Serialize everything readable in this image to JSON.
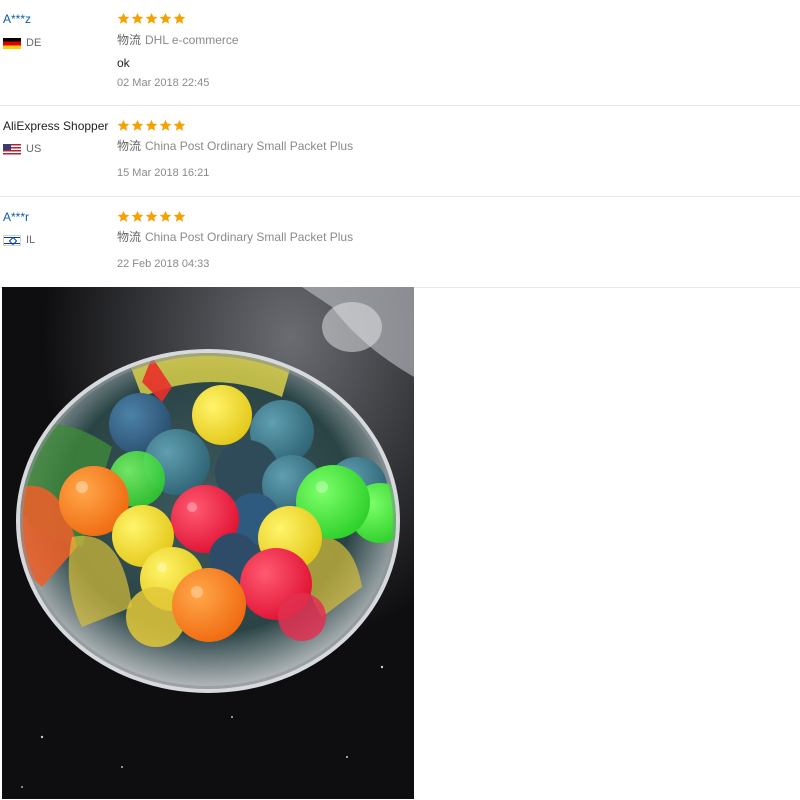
{
  "reviews": [
    {
      "name": "A***z",
      "country_code": "DE",
      "flag_icon": "germany-flag-icon",
      "rating": 5,
      "logistics_label": "物流",
      "logistics_value": "DHL e-commerce",
      "feedback": "ok",
      "date": "02 Mar 2018 22:45"
    },
    {
      "name": "AliExpress Shopper",
      "country_code": "US",
      "flag_icon": "usa-flag-icon",
      "rating": 5,
      "logistics_label": "物流",
      "logistics_value": "China Post Ordinary Small Packet Plus",
      "feedback": "",
      "date": "15 Mar 2018 16:21"
    },
    {
      "name": "A***r",
      "country_code": "IL",
      "flag_icon": "israel-flag-icon",
      "rating": 5,
      "logistics_label": "物流",
      "logistics_value": "China Post Ordinary Small Packet Plus",
      "feedback": "",
      "date": "22 Feb 2018 04:33"
    }
  ],
  "colors": {
    "star": "#f5a100",
    "masked_name": "#0b5ea8",
    "muted_text": "#8a8a8a",
    "divider": "#e8e8e8"
  },
  "photo": {
    "subject": "bouncy-balls-in-steel-bowl-image"
  }
}
